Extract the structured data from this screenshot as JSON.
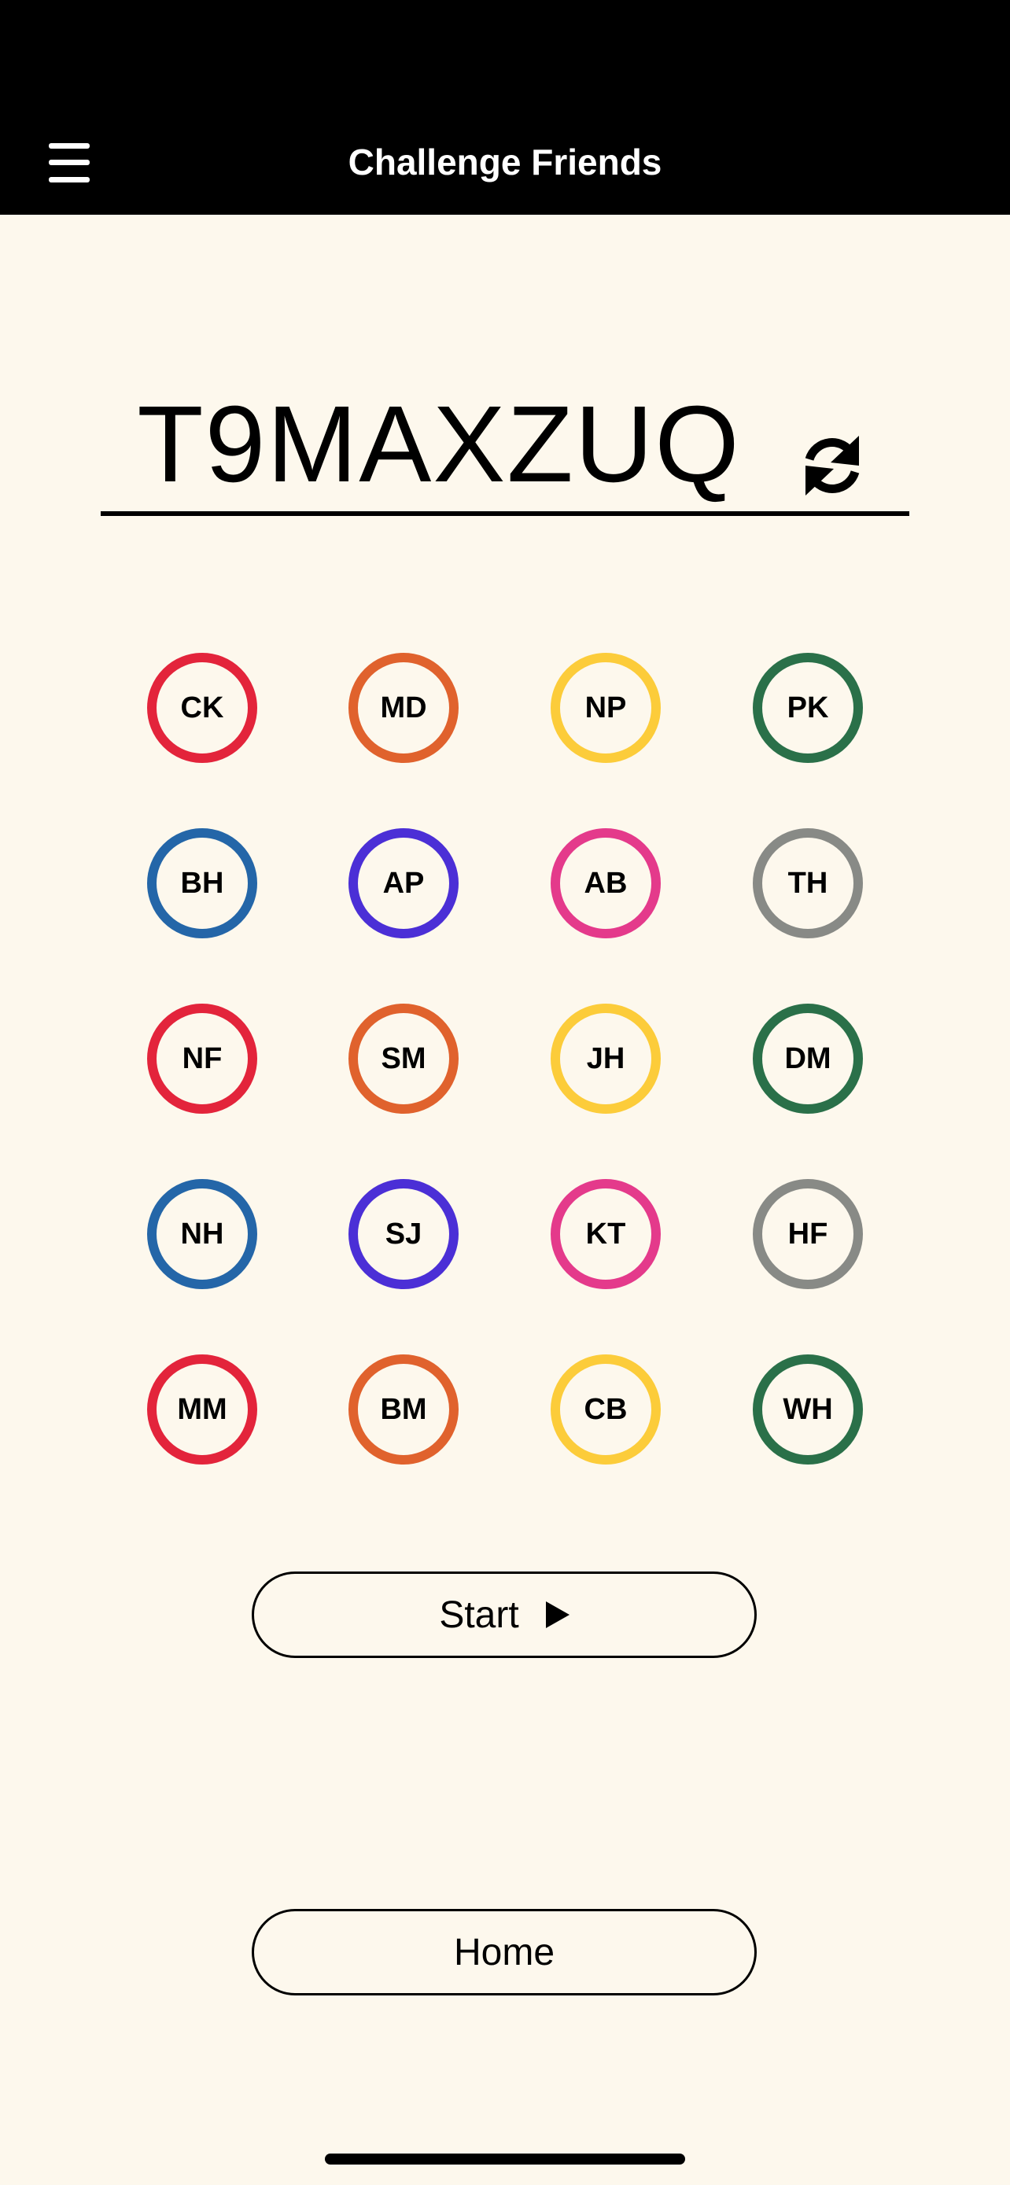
{
  "header": {
    "title": "Challenge Friends",
    "menu_icon": "hamburger-menu-icon"
  },
  "code": {
    "value": "T9MAXZUQ",
    "refresh_icon": "refresh-icon"
  },
  "friends": [
    {
      "initials": "CK",
      "color": "#e3243b"
    },
    {
      "initials": "MD",
      "color": "#e0622d"
    },
    {
      "initials": "NP",
      "color": "#fccc3a"
    },
    {
      "initials": "PK",
      "color": "#2a7049"
    },
    {
      "initials": "BH",
      "color": "#2466a8"
    },
    {
      "initials": "AP",
      "color": "#4b2fd6"
    },
    {
      "initials": "AB",
      "color": "#e43a8b"
    },
    {
      "initials": "TH",
      "color": "#888a86"
    },
    {
      "initials": "NF",
      "color": "#e3243b"
    },
    {
      "initials": "SM",
      "color": "#e0622d"
    },
    {
      "initials": "JH",
      "color": "#fccc3a"
    },
    {
      "initials": "DM",
      "color": "#2a7049"
    },
    {
      "initials": "NH",
      "color": "#2466a8"
    },
    {
      "initials": "SJ",
      "color": "#4b2fd6"
    },
    {
      "initials": "KT",
      "color": "#e43a8b"
    },
    {
      "initials": "HF",
      "color": "#888a86"
    },
    {
      "initials": "MM",
      "color": "#e3243b"
    },
    {
      "initials": "BM",
      "color": "#e0622d"
    },
    {
      "initials": "CB",
      "color": "#fccc3a"
    },
    {
      "initials": "WH",
      "color": "#2a7049"
    }
  ],
  "buttons": {
    "start_label": "Start",
    "start_icon": "play-icon",
    "home_label": "Home"
  },
  "colors": {
    "background": "#fdf8ed",
    "header": "#000000"
  }
}
